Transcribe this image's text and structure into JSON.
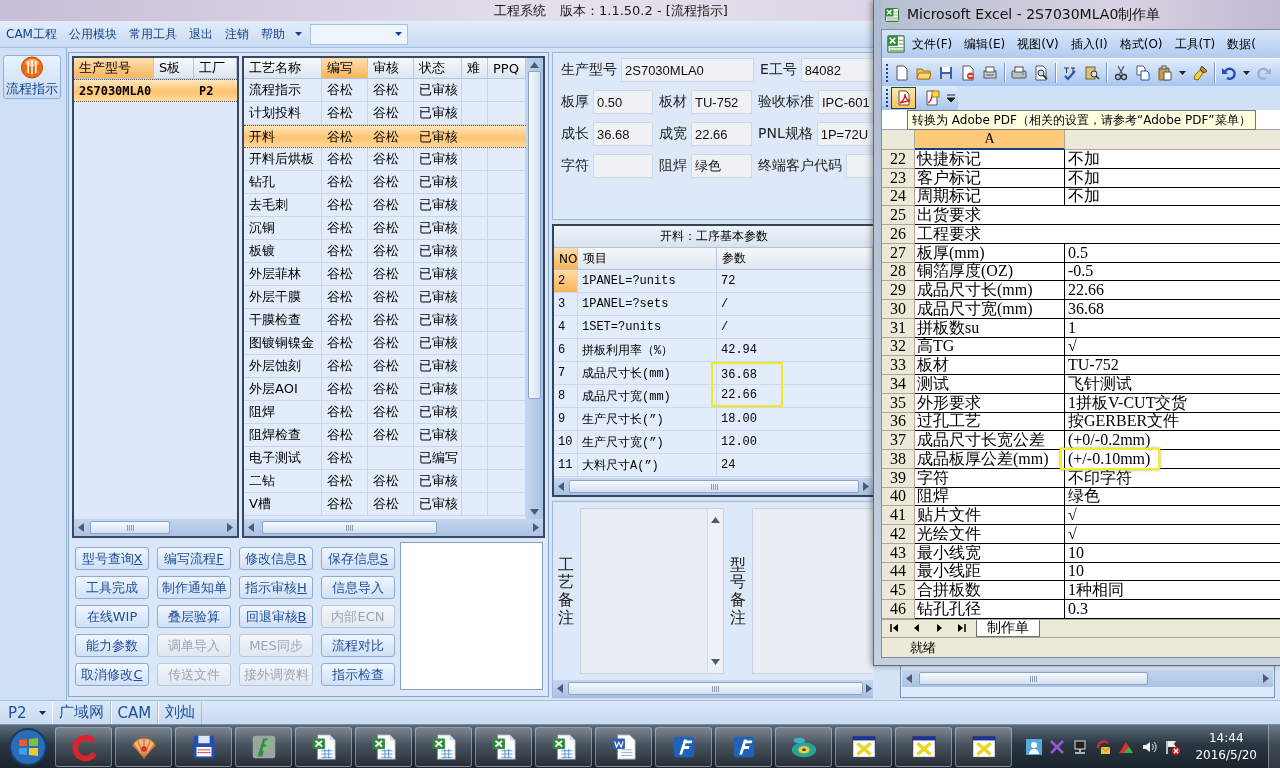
{
  "window": {
    "title": "工程系统",
    "subtitle": "版本：1.1.50.2 - [流程指示]"
  },
  "menu": [
    "CAM工程",
    "公用模块",
    "常用工具",
    "退出",
    "注销",
    "帮助"
  ],
  "nav": [
    {
      "label": "流程指示",
      "selected": true
    }
  ],
  "models": {
    "columns": [
      {
        "label": "生产型号",
        "selected": true
      },
      {
        "label": "S板",
        "selected": false
      },
      {
        "label": "工厂",
        "selected": false
      }
    ],
    "rows": [
      {
        "model": "2S7030MLA0",
        "factory": "P2",
        "selected": true
      }
    ]
  },
  "processes": {
    "columns": [
      {
        "label": "工艺名称",
        "selected": false
      },
      {
        "label": "编写",
        "selected": true
      },
      {
        "label": "审核",
        "selected": false
      },
      {
        "label": "状态",
        "selected": false
      },
      {
        "label": "难",
        "selected": false
      },
      {
        "label": "PPQ",
        "selected": false
      }
    ],
    "rows": [
      {
        "name": "流程指示",
        "writer": "谷松",
        "reviewer": "谷松",
        "status": "已审核",
        "selected": false
      },
      {
        "name": "计划投料",
        "writer": "谷松",
        "reviewer": "谷松",
        "status": "已审核",
        "selected": false
      },
      {
        "name": "开料",
        "writer": "谷松",
        "reviewer": "谷松",
        "status": "已审核",
        "selected": true
      },
      {
        "name": "开料后烘板",
        "writer": "谷松",
        "reviewer": "谷松",
        "status": "已审核",
        "selected": false
      },
      {
        "name": "钻孔",
        "writer": "谷松",
        "reviewer": "谷松",
        "status": "已审核",
        "selected": false
      },
      {
        "name": "去毛刺",
        "writer": "谷松",
        "reviewer": "谷松",
        "status": "已审核",
        "selected": false
      },
      {
        "name": "沉铜",
        "writer": "谷松",
        "reviewer": "谷松",
        "status": "已审核",
        "selected": false
      },
      {
        "name": "板镀",
        "writer": "谷松",
        "reviewer": "谷松",
        "status": "已审核",
        "selected": false
      },
      {
        "name": "外层菲林",
        "writer": "谷松",
        "reviewer": "谷松",
        "status": "已审核",
        "selected": false
      },
      {
        "name": "外层干膜",
        "writer": "谷松",
        "reviewer": "谷松",
        "status": "已审核",
        "selected": false
      },
      {
        "name": "干膜检查",
        "writer": "谷松",
        "reviewer": "谷松",
        "status": "已审核",
        "selected": false
      },
      {
        "name": "图镀铜镍金",
        "writer": "谷松",
        "reviewer": "谷松",
        "status": "已审核",
        "selected": false
      },
      {
        "name": "外层蚀刻",
        "writer": "谷松",
        "reviewer": "谷松",
        "status": "已审核",
        "selected": false
      },
      {
        "name": "外层AOI",
        "writer": "谷松",
        "reviewer": "谷松",
        "status": "已审核",
        "selected": false
      },
      {
        "name": "阻焊",
        "writer": "谷松",
        "reviewer": "谷松",
        "status": "已审核",
        "selected": false
      },
      {
        "name": "阻焊检查",
        "writer": "谷松",
        "reviewer": "谷松",
        "status": "已审核",
        "selected": false
      },
      {
        "name": "电子测试",
        "writer": "谷松",
        "status": "已编写",
        "selected": false
      },
      {
        "name": "二钻",
        "writer": "谷松",
        "reviewer": "谷松",
        "status": "已审核",
        "selected": false
      },
      {
        "name": "V槽",
        "writer": "谷松",
        "reviewer": "谷松",
        "status": "已审核",
        "selected": false
      }
    ]
  },
  "actions": [
    {
      "label": "型号查询",
      "key": "X",
      "disabled": false
    },
    {
      "label": "编写流程",
      "key": "F",
      "disabled": false
    },
    {
      "label": "修改信息",
      "key": "R",
      "disabled": false
    },
    {
      "label": "保存信息",
      "key": "S",
      "disabled": false
    },
    {
      "label": "工具完成",
      "disabled": false
    },
    {
      "label": "制作通知单",
      "disabled": false
    },
    {
      "label": "指示审核",
      "key": "H",
      "disabled": false
    },
    {
      "label": "信息导入",
      "disabled": false
    },
    {
      "label": "在线WIP",
      "disabled": false
    },
    {
      "label": "叠层验算",
      "disabled": false
    },
    {
      "label": "回退审核",
      "key": "B",
      "disabled": false
    },
    {
      "label": "内部ECN",
      "disabled": true
    },
    {
      "label": "能力参数",
      "disabled": false
    },
    {
      "label": "调单导入",
      "disabled": true
    },
    {
      "label": "MES同步",
      "disabled": true
    },
    {
      "label": "流程对比",
      "disabled": false
    },
    {
      "label": "取消修改",
      "key": "C",
      "disabled": false
    },
    {
      "label": "传送文件",
      "disabled": true
    },
    {
      "label": "接外调资料",
      "disabled": true
    },
    {
      "label": "指示检查",
      "disabled": false
    }
  ],
  "info": {
    "rows": [
      {
        "fields": [
          {
            "label": "生产型号",
            "value": "2S7030MLA0"
          },
          {
            "label": "E工号",
            "value": "84082"
          }
        ]
      },
      {
        "fields": [
          {
            "label": "板厚",
            "value": "0.50"
          },
          {
            "label": "板材",
            "value": "TU-752"
          },
          {
            "label": "验收标准",
            "value": "IPC-601"
          }
        ]
      },
      {
        "fields": [
          {
            "label": "成长",
            "value": "36.68"
          },
          {
            "label": "成宽",
            "value": "22.66"
          },
          {
            "label": "PNL规格",
            "value": "1P=72U"
          }
        ]
      },
      {
        "fields": [
          {
            "label": "字符"
          },
          {
            "label": "阻焊",
            "value": "绿色"
          },
          {
            "label": "终端客户代码"
          }
        ]
      }
    ]
  },
  "params": {
    "title": "开料：工序基本参数",
    "columns": [
      {
        "label": "NO",
        "selected": true
      },
      {
        "label": "项目",
        "selected": false
      },
      {
        "label": "参数",
        "selected": false
      }
    ],
    "rows": [
      {
        "no": "2",
        "item": "1PANEL=?units",
        "value": "72",
        "selected": true,
        "highlighted": false
      },
      {
        "no": "3",
        "item": "1PANEL=?sets",
        "value": "/",
        "selected": false,
        "highlighted": false
      },
      {
        "no": "4",
        "item": "1SET=?units",
        "value": "/",
        "selected": false,
        "highlighted": false
      },
      {
        "no": "6",
        "item": "拼板利用率（%）",
        "value": "42.94",
        "selected": false,
        "highlighted": false
      },
      {
        "no": "7",
        "item": "成品尺寸长(mm)",
        "value": "36.68",
        "selected": false,
        "highlighted": true
      },
      {
        "no": "8",
        "item": "成品尺寸宽(mm)",
        "value": "22.66",
        "selected": false,
        "highlighted": true
      },
      {
        "no": "9",
        "item": "生产尺寸长(”)",
        "value": "18.00",
        "selected": false,
        "highlighted": false
      },
      {
        "no": "10",
        "item": "生产尺寸宽(”)",
        "value": "12.00",
        "selected": false,
        "highlighted": false
      },
      {
        "no": "11",
        "item": "大料尺寸A(”)",
        "value": "24",
        "selected": false,
        "highlighted": false
      }
    ]
  },
  "remarks": [
    {
      "label": "工艺备注"
    },
    {
      "label": "型号备注"
    }
  ],
  "status_bar": {
    "dropdown": "P2",
    "items": [
      "广域网",
      "CAM",
      "刘灿"
    ]
  },
  "excel": {
    "title": "Microsoft Excel - 2S7030MLA0制作单",
    "menu": [
      "文件(F)",
      "编辑(E)",
      "视图(V)",
      "插入(I)",
      "格式(O)",
      "工具(T)",
      "数据("
    ],
    "pdf_buttons": [
      {
        "kind": "convert",
        "hovered": true
      },
      {
        "kind": "review",
        "hovered": false
      }
    ],
    "tooltip": "转换为 Adobe PDF（相关的设置，请参考“Adobe PDF”菜单）",
    "columns": [
      {
        "label": "A",
        "selected": true
      }
    ],
    "rows": [
      {
        "row": "22",
        "cells": [
          "快捷标记",
          "不加"
        ],
        "highlighted": false
      },
      {
        "row": "23",
        "cells": [
          "客户标记",
          "不加"
        ],
        "highlighted": false
      },
      {
        "row": "24",
        "cells": [
          "周期标记",
          "不加"
        ],
        "highlighted": false
      },
      {
        "row": "25",
        "cells": [
          "出货要求"
        ],
        "highlighted": false
      },
      {
        "row": "26",
        "cells": [
          "工程要求"
        ],
        "highlighted": false
      },
      {
        "row": "27",
        "cells": [
          "板厚(mm)",
          "0.5"
        ],
        "highlighted": false
      },
      {
        "row": "28",
        "cells": [
          "铜箔厚度(OZ)",
          "-0.5"
        ],
        "highlighted": false
      },
      {
        "row": "29",
        "cells": [
          "成品尺寸长(mm)",
          "22.66"
        ],
        "highlighted": false
      },
      {
        "row": "30",
        "cells": [
          "成品尺寸宽(mm)",
          "36.68"
        ],
        "highlighted": false
      },
      {
        "row": "31",
        "cells": [
          "拼板数su",
          "1"
        ],
        "highlighted": false
      },
      {
        "row": "32",
        "cells": [
          "高TG",
          "√"
        ],
        "highlighted": false
      },
      {
        "row": "33",
        "cells": [
          "板材",
          "TU-752"
        ],
        "highlighted": false
      },
      {
        "row": "34",
        "cells": [
          "测试",
          "飞针测试"
        ],
        "highlighted": false
      },
      {
        "row": "35",
        "cells": [
          "外形要求",
          "1拼板V-CUT交货"
        ],
        "highlighted": false
      },
      {
        "row": "36",
        "cells": [
          "过孔工艺",
          "按GERBER文件"
        ],
        "highlighted": false
      },
      {
        "row": "37",
        "cells": [
          "成品尺寸长宽公差",
          "(+0/-0.2mm)"
        ],
        "highlighted": false
      },
      {
        "row": "38",
        "cells": [
          "成品板厚公差(mm)",
          "(+/-0.10mm)"
        ],
        "highlighted": true
      },
      {
        "row": "39",
        "cells": [
          "字符",
          "不印字符"
        ],
        "highlighted": false
      },
      {
        "row": "40",
        "cells": [
          "阻焊",
          "绿色"
        ],
        "highlighted": false
      },
      {
        "row": "41",
        "cells": [
          "贴片文件",
          "√"
        ],
        "highlighted": false
      },
      {
        "row": "42",
        "cells": [
          "光绘文件",
          "√"
        ],
        "highlighted": false
      },
      {
        "row": "43",
        "cells": [
          "最小线宽",
          "10"
        ],
        "highlighted": false
      },
      {
        "row": "44",
        "cells": [
          "最小线距",
          "10"
        ],
        "highlighted": false
      },
      {
        "row": "45",
        "cells": [
          "合拼板数",
          "1种相同"
        ],
        "highlighted": false
      },
      {
        "row": "46",
        "cells": [
          "钻孔孔径",
          "0.3"
        ],
        "highlighted": false
      }
    ],
    "sheets": [
      {
        "label": "制作单",
        "selected": true
      }
    ],
    "status": "就绪"
  },
  "taskbar": {
    "time": "14:44",
    "date": "2016/5/20"
  }
}
